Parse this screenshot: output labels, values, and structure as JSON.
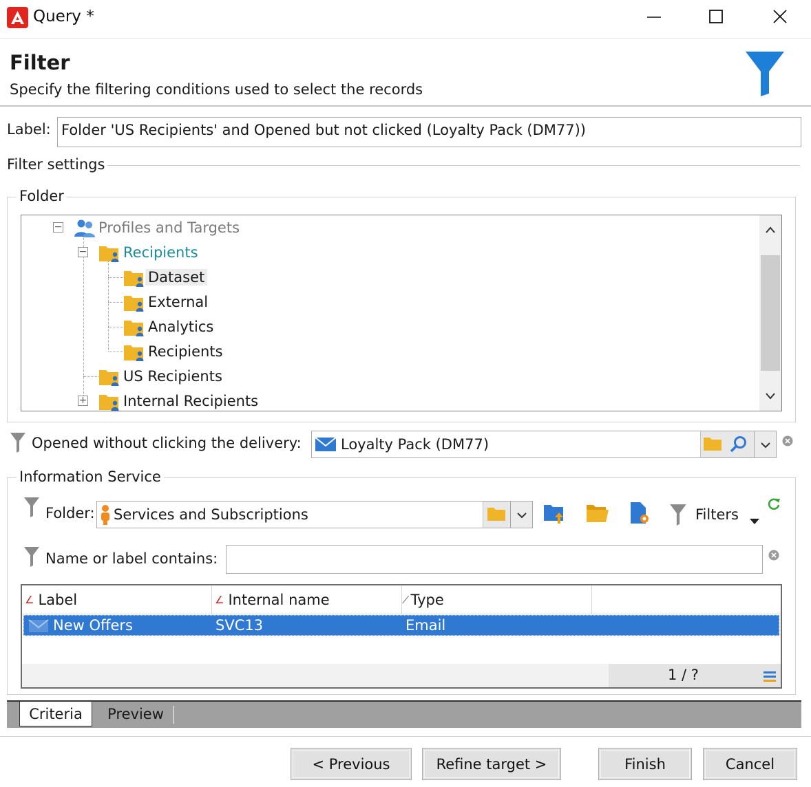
{
  "window": {
    "title": "Query *",
    "controls": [
      "minimize",
      "maximize",
      "close"
    ]
  },
  "header": {
    "title": "Filter",
    "subtitle": "Specify the filtering conditions used to select the records",
    "icon": "funnel-icon"
  },
  "label_field": {
    "caption": "Label:",
    "value": "Folder 'US Recipients' and Opened but not clicked (Loyalty Pack (DM77))"
  },
  "filter_settings": {
    "title": "Filter settings",
    "folder_group": {
      "title": "Folder",
      "tree": [
        {
          "label": "Profiles and Targets",
          "icon": "people-icon",
          "expander": "−",
          "state": "dimmed"
        },
        {
          "label": "Recipients",
          "icon": "folder-person-icon",
          "expander": "−",
          "state": "accent"
        },
        {
          "label": "Dataset",
          "icon": "folder-person-icon",
          "state": "hovered"
        },
        {
          "label": "External",
          "icon": "folder-person-icon"
        },
        {
          "label": "Analytics",
          "icon": "folder-person-icon"
        },
        {
          "label": "Recipients",
          "icon": "folder-person-icon"
        },
        {
          "label": "US Recipients",
          "icon": "folder-person-icon"
        },
        {
          "label": "Internal Recipients",
          "icon": "folder-person-icon",
          "expander": "+"
        }
      ]
    },
    "delivery": {
      "caption": "Opened without clicking the delivery:",
      "value": "Loyalty Pack (DM77)"
    },
    "information_service": {
      "title": "Information Service",
      "folder_caption": "Folder:",
      "folder_value": "Services and Subscriptions",
      "filters_label": "Filters",
      "name_caption": "Name or label contains:",
      "name_value": "",
      "grid": {
        "columns": [
          "Label",
          "Internal name",
          "Type"
        ],
        "rows": [
          {
            "label": "New Offers",
            "internal_name": "SVC13",
            "type": "Email",
            "selected": true
          }
        ],
        "pager": "1 / ?"
      }
    }
  },
  "tabs": [
    {
      "label": "Criteria",
      "active": true
    },
    {
      "label": "Preview",
      "active": false
    }
  ],
  "buttons": {
    "previous": "< Previous",
    "refine": "Refine target >",
    "finish": "Finish",
    "cancel": "Cancel"
  },
  "colors": {
    "accent": "#2f79d2",
    "folder": "#f0b429",
    "brand": "#e0261f",
    "funnel": "#1e7fd8",
    "tree_accent": "#1b8a9a"
  }
}
